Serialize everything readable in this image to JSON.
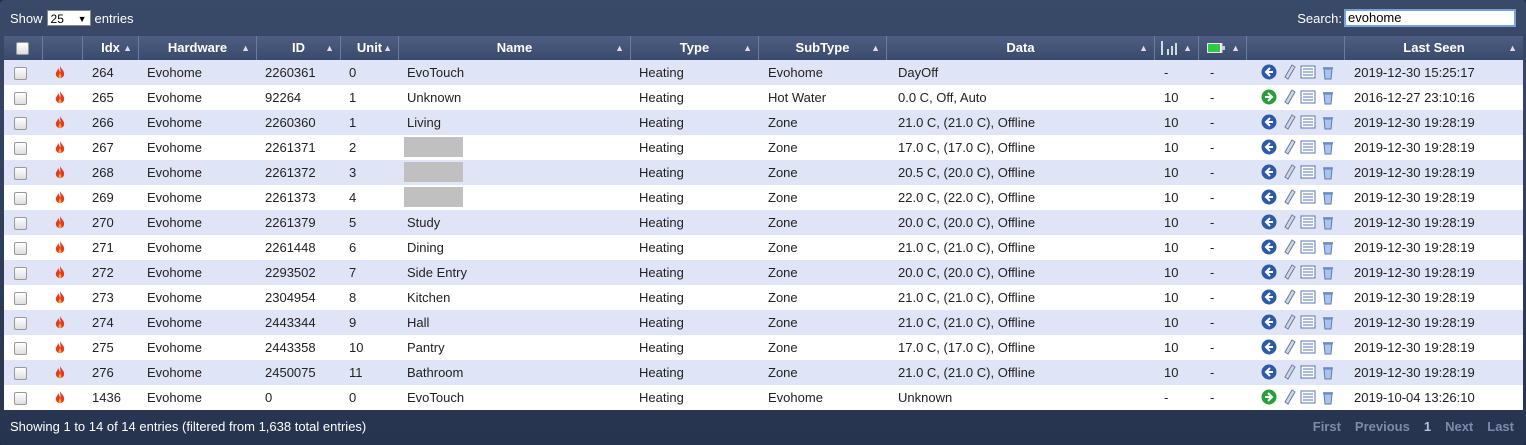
{
  "top": {
    "show_label": "Show",
    "page_size": "25",
    "entries_label": "entries",
    "search_label": "Search:",
    "search_value": "evohome"
  },
  "headers": {
    "idx": "Idx",
    "hardware": "Hardware",
    "id": "ID",
    "unit": "Unit",
    "name": "Name",
    "type": "Type",
    "subtype": "SubType",
    "data": "Data",
    "last_seen": "Last Seen"
  },
  "rows": [
    {
      "idx": "264",
      "hardware": "Evohome",
      "id": "2260361",
      "unit": "0",
      "name": "EvoTouch",
      "type": "Heating",
      "subtype": "Evohome",
      "data": "DayOff",
      "signal": "-",
      "battery": "-",
      "last_seen": "2019-12-30 15:25:17",
      "redacted": false,
      "first": "back"
    },
    {
      "idx": "265",
      "hardware": "Evohome",
      "id": "92264",
      "unit": "1",
      "name": "Unknown",
      "type": "Heating",
      "subtype": "Hot Water",
      "data": "0.0 C, Off, Auto",
      "signal": "10",
      "battery": "-",
      "last_seen": "2016-12-27 23:10:16",
      "redacted": false,
      "first": "add"
    },
    {
      "idx": "266",
      "hardware": "Evohome",
      "id": "2260360",
      "unit": "1",
      "name": "Living",
      "type": "Heating",
      "subtype": "Zone",
      "data": "21.0 C, (21.0 C), Offline",
      "signal": "10",
      "battery": "-",
      "last_seen": "2019-12-30 19:28:19",
      "redacted": false,
      "first": "back"
    },
    {
      "idx": "267",
      "hardware": "Evohome",
      "id": "2261371",
      "unit": "2",
      "name": "",
      "type": "Heating",
      "subtype": "Zone",
      "data": "17.0 C, (17.0 C), Offline",
      "signal": "10",
      "battery": "-",
      "last_seen": "2019-12-30 19:28:19",
      "redacted": true,
      "first": "back"
    },
    {
      "idx": "268",
      "hardware": "Evohome",
      "id": "2261372",
      "unit": "3",
      "name": "",
      "type": "Heating",
      "subtype": "Zone",
      "data": "20.5 C, (20.0 C), Offline",
      "signal": "10",
      "battery": "-",
      "last_seen": "2019-12-30 19:28:19",
      "redacted": true,
      "first": "back"
    },
    {
      "idx": "269",
      "hardware": "Evohome",
      "id": "2261373",
      "unit": "4",
      "name": "",
      "type": "Heating",
      "subtype": "Zone",
      "data": "22.0 C, (22.0 C), Offline",
      "signal": "10",
      "battery": "-",
      "last_seen": "2019-12-30 19:28:19",
      "redacted": true,
      "first": "back"
    },
    {
      "idx": "270",
      "hardware": "Evohome",
      "id": "2261379",
      "unit": "5",
      "name": "Study",
      "type": "Heating",
      "subtype": "Zone",
      "data": "20.0 C, (20.0 C), Offline",
      "signal": "10",
      "battery": "-",
      "last_seen": "2019-12-30 19:28:19",
      "redacted": false,
      "first": "back"
    },
    {
      "idx": "271",
      "hardware": "Evohome",
      "id": "2261448",
      "unit": "6",
      "name": "Dining",
      "type": "Heating",
      "subtype": "Zone",
      "data": "21.0 C, (21.0 C), Offline",
      "signal": "10",
      "battery": "-",
      "last_seen": "2019-12-30 19:28:19",
      "redacted": false,
      "first": "back"
    },
    {
      "idx": "272",
      "hardware": "Evohome",
      "id": "2293502",
      "unit": "7",
      "name": "Side Entry",
      "type": "Heating",
      "subtype": "Zone",
      "data": "20.0 C, (20.0 C), Offline",
      "signal": "10",
      "battery": "-",
      "last_seen": "2019-12-30 19:28:19",
      "redacted": false,
      "first": "back"
    },
    {
      "idx": "273",
      "hardware": "Evohome",
      "id": "2304954",
      "unit": "8",
      "name": "Kitchen",
      "type": "Heating",
      "subtype": "Zone",
      "data": "21.0 C, (21.0 C), Offline",
      "signal": "10",
      "battery": "-",
      "last_seen": "2019-12-30 19:28:19",
      "redacted": false,
      "first": "back"
    },
    {
      "idx": "274",
      "hardware": "Evohome",
      "id": "2443344",
      "unit": "9",
      "name": "Hall",
      "type": "Heating",
      "subtype": "Zone",
      "data": "21.0 C, (21.0 C), Offline",
      "signal": "10",
      "battery": "-",
      "last_seen": "2019-12-30 19:28:19",
      "redacted": false,
      "first": "back"
    },
    {
      "idx": "275",
      "hardware": "Evohome",
      "id": "2443358",
      "unit": "10",
      "name": "Pantry",
      "type": "Heating",
      "subtype": "Zone",
      "data": "17.0 C, (17.0 C), Offline",
      "signal": "10",
      "battery": "-",
      "last_seen": "2019-12-30 19:28:19",
      "redacted": false,
      "first": "back"
    },
    {
      "idx": "276",
      "hardware": "Evohome",
      "id": "2450075",
      "unit": "11",
      "name": "Bathroom",
      "type": "Heating",
      "subtype": "Zone",
      "data": "21.0 C, (21.0 C), Offline",
      "signal": "10",
      "battery": "-",
      "last_seen": "2019-12-30 19:28:19",
      "redacted": false,
      "first": "back"
    },
    {
      "idx": "1436",
      "hardware": "Evohome",
      "id": "0",
      "unit": "0",
      "name": "EvoTouch",
      "type": "Heating",
      "subtype": "Evohome",
      "data": "Unknown",
      "signal": "-",
      "battery": "-",
      "last_seen": "2019-10-04 13:26:10",
      "redacted": false,
      "first": "add"
    }
  ],
  "footer": {
    "info": "Showing 1 to 14 of 14 entries (filtered from 1,638 total entries)",
    "first": "First",
    "previous": "Previous",
    "page": "1",
    "next": "Next",
    "last": "Last"
  },
  "colors": {
    "row_odd": "#e0e4f7",
    "row_even": "#ffffff",
    "header": "#3a4a6b",
    "frame": "#2b3a58"
  },
  "icons": {
    "flame": "flame-icon",
    "back": "back-arrow-icon",
    "add": "add-arrow-icon",
    "edit": "pencil-icon",
    "log": "log-icon",
    "delete": "trash-icon",
    "signal": "signal-icon",
    "battery": "battery-icon"
  }
}
